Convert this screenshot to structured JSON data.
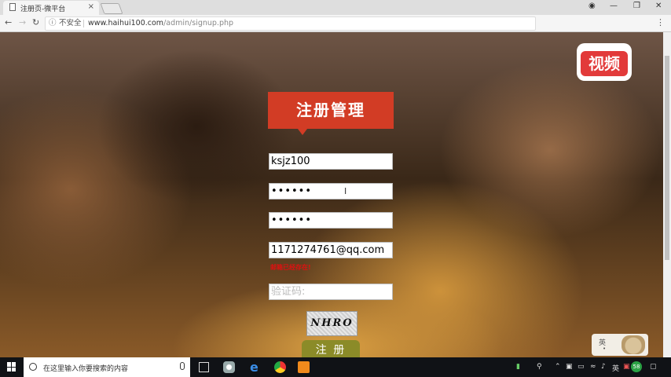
{
  "browser": {
    "tab_title": "注册页-微平台",
    "tab_close": "×",
    "security_label": "不安全",
    "url_host": "www.haihui100.com",
    "url_path": "/admin/signup.php"
  },
  "page": {
    "logo_text": "视频",
    "form_title": "注册管理",
    "username_value": "ksjz100",
    "password_value": "••••••",
    "confirm_password_value": "••••••",
    "email_value": "1171274761@qq.com",
    "email_error": "邮箱已经存在!",
    "captcha_placeholder": "验证码:",
    "captcha_text": "NHRO",
    "submit_label": "注 册"
  },
  "ime": {
    "mode": "英",
    "sub": "•"
  },
  "taskbar": {
    "search_placeholder": "在这里输入你要搜索的内容",
    "tray_lang": "英",
    "tray_badge": "58"
  },
  "colors": {
    "accent_red": "#d23c25",
    "submit_olive": "#8b8b28",
    "error_red": "#e01010"
  }
}
